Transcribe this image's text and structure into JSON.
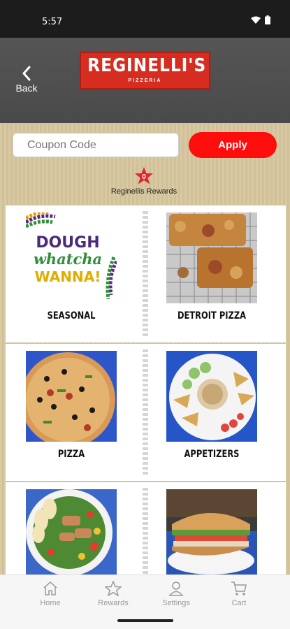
{
  "status": {
    "time": "5:57"
  },
  "header": {
    "back_label": "Back",
    "logo_main": "REGINELLI'S",
    "logo_sub": "PIZZERIA"
  },
  "coupon": {
    "placeholder": "Coupon Code",
    "apply_label": "Apply"
  },
  "rewards": {
    "count": "0",
    "label": "Reginellis Rewards"
  },
  "categories": [
    {
      "label": "SEASONAL",
      "image_text": [
        "DOUGH",
        "whatcha",
        "WANNA!"
      ]
    },
    {
      "label": "DETROIT PIZZA"
    },
    {
      "label": "PIZZA"
    },
    {
      "label": "APPETIZERS"
    },
    {
      "label": ""
    },
    {
      "label": ""
    }
  ],
  "tabbar": {
    "home": "Home",
    "rewards": "Rewards",
    "settings": "Settings",
    "cart": "Cart"
  },
  "colors": {
    "accent": "#fe0d0d",
    "logo": "#d62d20",
    "header": "#4f4f4f"
  }
}
